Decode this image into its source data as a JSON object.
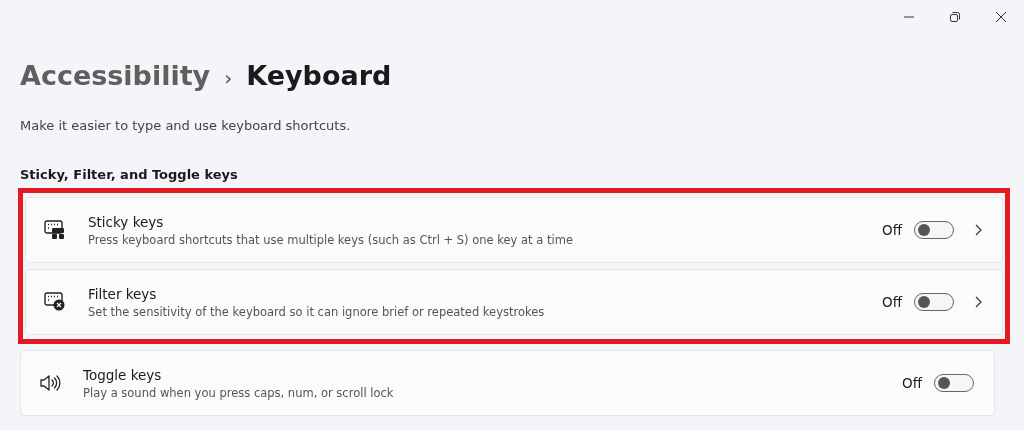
{
  "breadcrumb": {
    "parent": "Accessibility",
    "separator": "›",
    "current": "Keyboard"
  },
  "description": "Make it easier to type and use keyboard shortcuts.",
  "section": {
    "title": "Sticky, Filter, and Toggle keys",
    "groups": [
      {
        "highlighted": true,
        "items": [
          {
            "kind": "sticky",
            "title": "Sticky keys",
            "subtitle": "Press keyboard shortcuts that use multiple keys (such as Ctrl + S) one key at a time",
            "state_label": "Off",
            "on": false,
            "chevron": true
          },
          {
            "kind": "filter",
            "title": "Filter keys",
            "subtitle": "Set the sensitivity of the keyboard so it can ignore brief or repeated keystrokes",
            "state_label": "Off",
            "on": false,
            "chevron": true
          }
        ]
      },
      {
        "highlighted": false,
        "items": [
          {
            "kind": "sound",
            "title": "Toggle keys",
            "subtitle": "Play a sound when you press caps, num, or scroll lock",
            "state_label": "Off",
            "on": false,
            "chevron": false
          }
        ]
      }
    ]
  }
}
